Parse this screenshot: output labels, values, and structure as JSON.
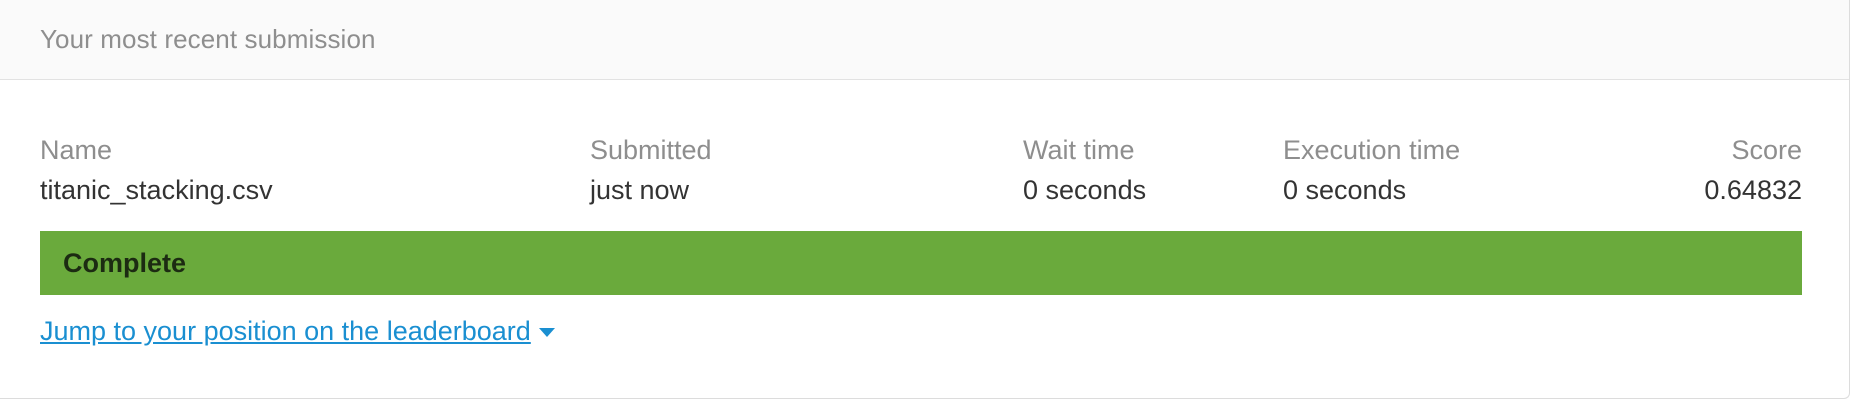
{
  "header": {
    "title": "Your most recent submission"
  },
  "submission": {
    "columns": {
      "name": "Name",
      "submitted": "Submitted",
      "wait_time": "Wait time",
      "execution_time": "Execution time",
      "score": "Score"
    },
    "values": {
      "name": "titanic_stacking.csv",
      "submitted": "just now",
      "wait_time": "0 seconds",
      "execution_time": "0 seconds",
      "score": "0.64832"
    }
  },
  "status": {
    "label": "Complete",
    "color": "#6aaa3c"
  },
  "leaderboard_link": {
    "label": "Jump to your position on the leaderboard",
    "icon": "caret-down-icon",
    "color": "#1a8fd1"
  }
}
